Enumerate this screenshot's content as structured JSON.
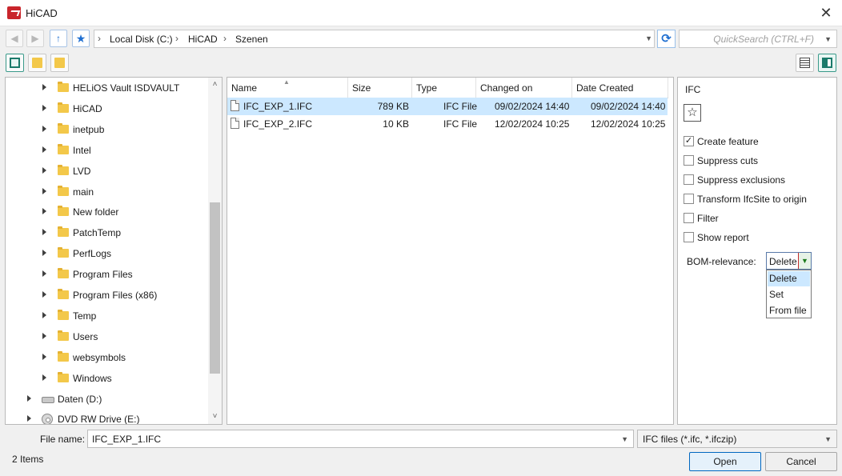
{
  "window": {
    "title": "HiCAD"
  },
  "address": {
    "crumbs": [
      "Local Disk (C:)",
      "HiCAD",
      "Szenen"
    ],
    "search_placeholder": "QuickSearch (CTRL+F)"
  },
  "tree": {
    "items": [
      {
        "label": "HELiOS Vault ISDVAULT",
        "type": "folder"
      },
      {
        "label": "HiCAD",
        "type": "folder"
      },
      {
        "label": "inetpub",
        "type": "folder"
      },
      {
        "label": "Intel",
        "type": "folder"
      },
      {
        "label": "LVD",
        "type": "folder"
      },
      {
        "label": "main",
        "type": "folder"
      },
      {
        "label": "New folder",
        "type": "folder"
      },
      {
        "label": "PatchTemp",
        "type": "folder"
      },
      {
        "label": "PerfLogs",
        "type": "folder"
      },
      {
        "label": "Program Files",
        "type": "folder"
      },
      {
        "label": "Program Files (x86)",
        "type": "folder"
      },
      {
        "label": "Temp",
        "type": "folder"
      },
      {
        "label": "Users",
        "type": "folder"
      },
      {
        "label": "websymbols",
        "type": "folder"
      },
      {
        "label": "Windows",
        "type": "folder"
      },
      {
        "label": "Daten (D:)",
        "type": "drive"
      },
      {
        "label": "DVD RW Drive (E:)",
        "type": "disc"
      }
    ]
  },
  "files": {
    "columns": [
      "Name",
      "Size",
      "Type",
      "Changed on",
      "Date Created"
    ],
    "rows": [
      {
        "name": "IFC_EXP_1.IFC",
        "size": "789 KB",
        "type": "IFC File",
        "changed": "09/02/2024 14:40",
        "created": "09/02/2024 14:40",
        "selected": true
      },
      {
        "name": "IFC_EXP_2.IFC",
        "size": "10 KB",
        "type": "IFC File",
        "changed": "12/02/2024 10:25",
        "created": "12/02/2024 10:25",
        "selected": false
      }
    ]
  },
  "props": {
    "title": "IFC",
    "options": [
      {
        "label": "Create feature",
        "checked": true
      },
      {
        "label": "Suppress cuts",
        "checked": false
      },
      {
        "label": "Suppress exclusions",
        "checked": false
      },
      {
        "label": "Transform IfcSite to origin",
        "checked": false
      },
      {
        "label": "Filter",
        "checked": false
      },
      {
        "label": "Show report",
        "checked": false
      }
    ],
    "bom_label": "BOM-relevance:",
    "bom_value": "Delete",
    "bom_options": [
      "Delete",
      "Set",
      "From file"
    ]
  },
  "footer": {
    "filename_label": "File name:",
    "filename_value": "IFC_EXP_1.IFC",
    "filetype": "IFC files (*.ifc, *.ifczip)",
    "status": "2  Items",
    "open_label": "Open",
    "cancel_label": "Cancel"
  }
}
